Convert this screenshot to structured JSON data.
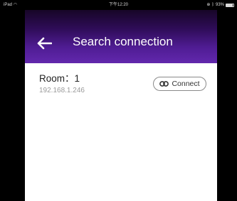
{
  "status_bar": {
    "device": "iPad",
    "time": "下午12:20",
    "battery_text": "93%",
    "battery_level": 0.93
  },
  "header": {
    "title": "Search connection",
    "back_icon": "arrow-left-icon"
  },
  "connections": [
    {
      "room_label": "Room：1",
      "ip": "192.168.1.246",
      "connect_label": "Connect",
      "connect_icon": "link-icon"
    }
  ],
  "colors": {
    "header_gradient_top": "#170627",
    "header_gradient_bottom": "#6228ad",
    "background": "#ffffff",
    "outer_frame": "#000000"
  }
}
